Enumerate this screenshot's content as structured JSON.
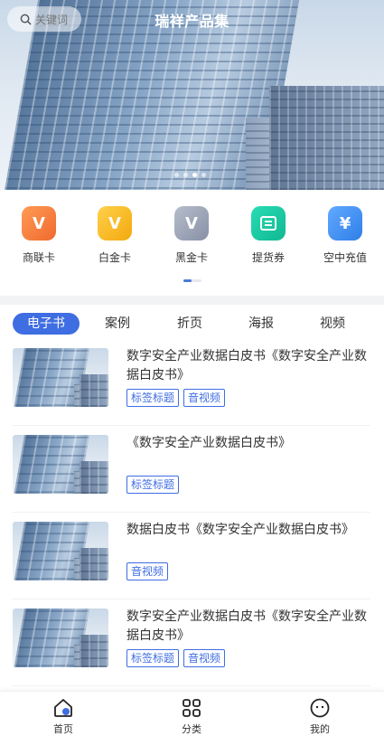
{
  "header": {
    "title": "瑞祥产品集",
    "search_placeholder": "关键词"
  },
  "menu": [
    {
      "label": "商联卡",
      "icon": "shanglian-card-icon",
      "color": "#f37a3a",
      "glyph": "V商"
    },
    {
      "label": "白金卡",
      "icon": "platinum-card-icon",
      "color": "#f5b417",
      "glyph": "V白"
    },
    {
      "label": "黑金卡",
      "icon": "black-gold-card-icon",
      "color": "#9aa3b8",
      "glyph": "V黑"
    },
    {
      "label": "提货券",
      "icon": "voucher-icon",
      "color": "#19c9a3",
      "glyph": "券"
    },
    {
      "label": "空中充值",
      "icon": "recharge-icon",
      "color": "#3e8ff0",
      "glyph": "¥"
    }
  ],
  "tabs": [
    "电子书",
    "案例",
    "折页",
    "海报",
    "视频"
  ],
  "active_tab": "电子书",
  "items": [
    {
      "title": "数字安全产业数据白皮书《数字安全产业数据白皮书》",
      "tags": [
        "标签标题",
        "音视频"
      ]
    },
    {
      "title": "《数字安全产业数据白皮书》",
      "tags": [
        "标签标题"
      ]
    },
    {
      "title": "数据白皮书《数字安全产业数据白皮书》",
      "tags": [
        "音视频"
      ]
    },
    {
      "title": "数字安全产业数据白皮书《数字安全产业数据白皮书》",
      "tags": [
        "标签标题",
        "音视频"
      ]
    }
  ],
  "nav": [
    {
      "label": "首页",
      "icon": "home-icon"
    },
    {
      "label": "分类",
      "icon": "category-grid-icon"
    },
    {
      "label": "我的",
      "icon": "profile-face-icon"
    }
  ],
  "colors": {
    "accent": "#3f6de2",
    "divider": "#f2f3f5"
  }
}
